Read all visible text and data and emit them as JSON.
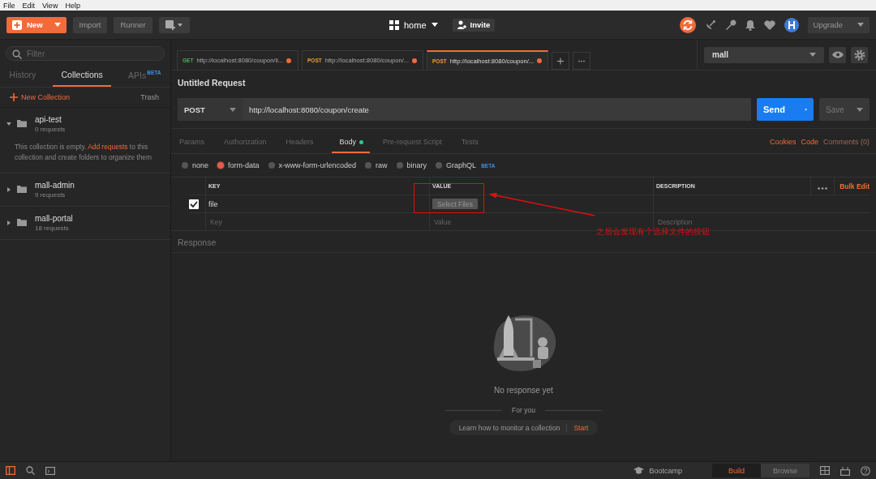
{
  "menu": [
    "File",
    "Edit",
    "View",
    "Help"
  ],
  "toolbar": {
    "new_label": "New",
    "import_label": "Import",
    "runner_label": "Runner",
    "workspace": "home",
    "invite": "Invite",
    "upgrade": "Upgrade"
  },
  "sidebar": {
    "filter_placeholder": "Filter",
    "tabs": [
      {
        "label": "History",
        "selected": false
      },
      {
        "label": "Collections",
        "selected": true
      },
      {
        "label": "APIs",
        "badge": "BETA",
        "selected": false
      }
    ],
    "new_collection": "New Collection",
    "trash": "Trash",
    "collections": [
      {
        "name": "api-test",
        "count": "0 requests",
        "expanded": true,
        "empty_note": {
          "before": "This collection is empty. ",
          "link": "Add requests",
          "after": " to this collection and create folders to organize them"
        }
      },
      {
        "name": "mall-admin",
        "count": "9 requests",
        "expanded": false
      },
      {
        "name": "mall-portal",
        "count": "18 requests",
        "expanded": false
      }
    ]
  },
  "request_tabs": [
    {
      "method": "GET",
      "url": "http://localhost:8080/coupon/li...",
      "selected": false,
      "unsaved": true
    },
    {
      "method": "POST",
      "url": "http://localhost:8080/coupon/...",
      "selected": false,
      "unsaved": true
    },
    {
      "method": "POST",
      "url": "http://localhost:8080/coupon/...",
      "selected": true,
      "unsaved": true
    }
  ],
  "environment": "mall",
  "request": {
    "title": "Untitled Request",
    "method": "POST",
    "url": "http://localhost:8080/coupon/create",
    "send": "Send",
    "save": "Save"
  },
  "section_tabs": [
    {
      "label": "Params",
      "selected": false,
      "dot": false
    },
    {
      "label": "Authorization",
      "selected": false,
      "dot": false
    },
    {
      "label": "Headers",
      "selected": false,
      "dot": false
    },
    {
      "label": "Body",
      "selected": true,
      "dot": true
    },
    {
      "label": "Pre-request Script",
      "selected": false,
      "dot": false
    },
    {
      "label": "Tests",
      "selected": false,
      "dot": false
    }
  ],
  "side_links": [
    {
      "label": "Cookies",
      "disabled": false
    },
    {
      "label": "Code",
      "disabled": false
    },
    {
      "label": "Comments (0)",
      "disabled": true
    }
  ],
  "body_types": [
    {
      "label": "none",
      "selected": false
    },
    {
      "label": "form-data",
      "selected": true
    },
    {
      "label": "x-www-form-urlencoded",
      "selected": false
    },
    {
      "label": "raw",
      "selected": false
    },
    {
      "label": "binary",
      "selected": false
    },
    {
      "label": "GraphQL",
      "badge": "BETA",
      "selected": false
    }
  ],
  "table": {
    "columns": [
      "KEY",
      "VALUE",
      "DESCRIPTION"
    ],
    "bulk_edit": "Bulk Edit",
    "rows": [
      {
        "checked": true,
        "key": "file",
        "value_button": "Select Files"
      }
    ],
    "new_row": {
      "key_placeholder": "Key",
      "value_placeholder": "Value",
      "description_placeholder": "Description"
    }
  },
  "response": {
    "label": "Response",
    "empty": "No response yet",
    "for_you": "For you",
    "tip": "Learn how to monitor a collection",
    "tip_action": "Start"
  },
  "annotation": {
    "text": "之后会发现有个选择文件的按钮"
  },
  "status_bar": {
    "bootcamp": "Bootcamp",
    "modes": [
      {
        "label": "Build",
        "selected": true
      },
      {
        "label": "Browse",
        "selected": false
      }
    ]
  }
}
